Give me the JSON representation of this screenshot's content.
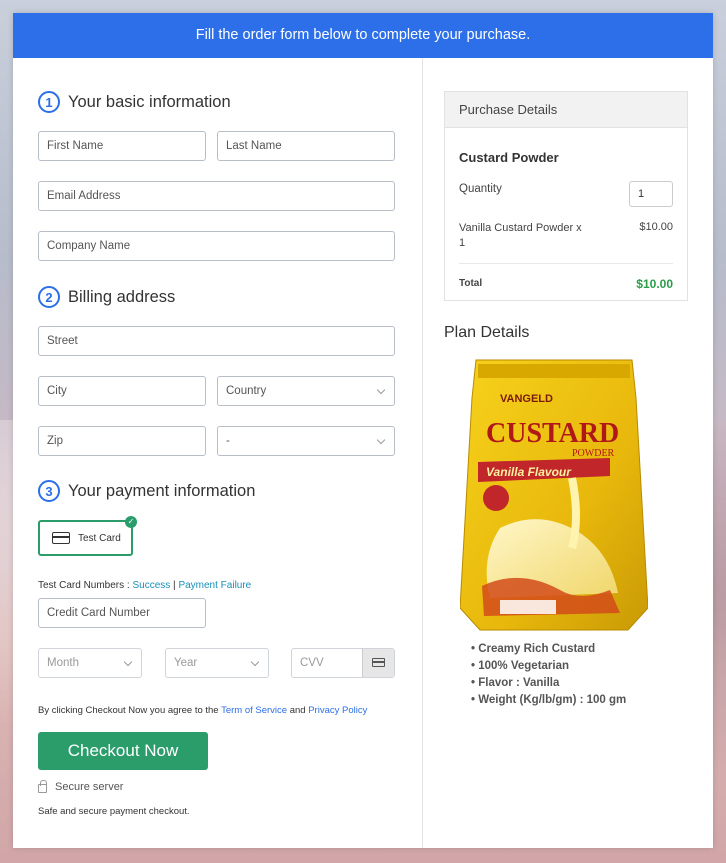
{
  "banner": "Fill the order form below to complete your purchase.",
  "sections": {
    "basic": {
      "num": "1",
      "title": "Your basic information"
    },
    "billing": {
      "num": "2",
      "title": "Billing address"
    },
    "payment": {
      "num": "3",
      "title": "Your payment information"
    }
  },
  "fields": {
    "first_name": "First Name",
    "last_name": "Last Name",
    "email": "Email Address",
    "company": "Company Name",
    "street": "Street",
    "city": "City",
    "country": "Country",
    "zip": "Zip",
    "state": "-",
    "card_number": "Credit Card Number",
    "month": "Month",
    "year": "Year",
    "cvv": "CVV"
  },
  "payment": {
    "option_label": "Test Card",
    "test_numbers_label": "Test Card Numbers : ",
    "success_link": "Success",
    "separator": " | ",
    "failure_link": "Payment Failure"
  },
  "terms": {
    "prefix": "By clicking Checkout Now you agree to the ",
    "tos": "Term of Service",
    "and": " and ",
    "privacy": "Privacy Policy"
  },
  "checkout_button": "Checkout Now",
  "secure_server": "Secure server",
  "secure_note": "Safe and secure payment checkout.",
  "purchase": {
    "header": "Purchase Details",
    "product": "Custard Powder",
    "quantity_label": "Quantity",
    "quantity_value": "1",
    "line_item": "Vanilla Custard Powder x 1",
    "line_price": "$10.00",
    "total_label": "Total",
    "total_value": "$10.00"
  },
  "plan": {
    "title": "Plan Details",
    "product_image_brand": "VANGELD",
    "product_image_title": "CUSTARD",
    "product_image_sub": "POWDER",
    "product_image_flavour": "Vanilla Flavour",
    "features": [
      "Creamy Rich Custard",
      "100% Vegetarian",
      "Flavor : Vanilla",
      "Weight (Kg/lb/gm) : 100 gm"
    ]
  },
  "colors": {
    "accent": "#2c6fe8",
    "success": "#2a9d6b",
    "total_green": "#2a9d4b"
  }
}
